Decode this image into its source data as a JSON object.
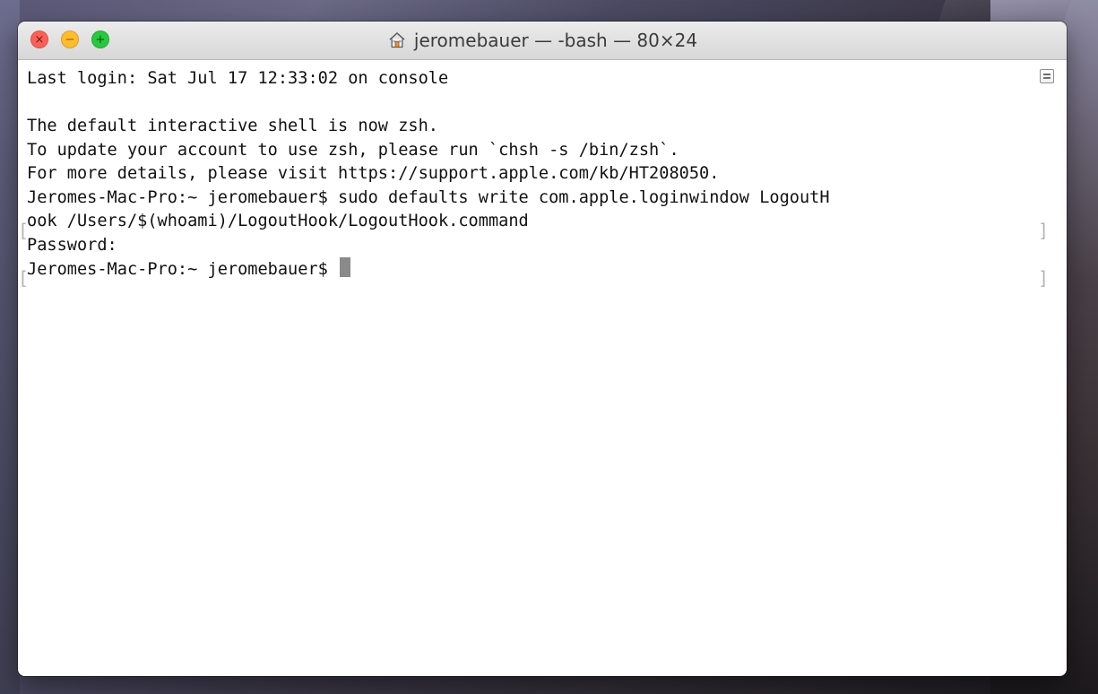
{
  "window": {
    "title": "jeromebauer — -bash — 80×24"
  },
  "terminal": {
    "lines": [
      "Last login: Sat Jul 17 12:33:02 on console",
      "",
      "The default interactive shell is now zsh.",
      "To update your account to use zsh, please run `chsh -s /bin/zsh`.",
      "For more details, please visit https://support.apple.com/kb/HT208050.",
      "Jeromes-Mac-Pro:~ jeromebauer$ sudo defaults write com.apple.loginwindow LogoutH",
      "ook /Users/$(whoami)/LogoutHook/LogoutHook.command",
      "Password:",
      "Jeromes-Mac-Pro:~ jeromebauer$ "
    ]
  },
  "icons": {
    "close": "close-icon",
    "minimize": "minimize-icon",
    "fullscreen": "fullscreen-icon",
    "home": "home-icon",
    "scroll_menu": "scroll-menu-icon"
  },
  "colors": {
    "close": "#fe5f57",
    "minimize": "#febc2e",
    "fullscreen": "#28c840",
    "cursor": "#8a8a8a"
  }
}
